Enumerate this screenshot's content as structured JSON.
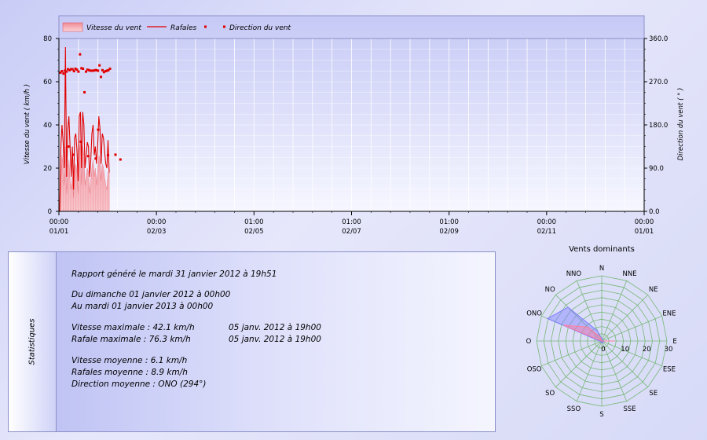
{
  "chart_data": [
    {
      "type": "line",
      "legend": {
        "placement": "top",
        "items": [
          {
            "label": "Vitesse du vent",
            "kind": "area",
            "color": "#f0a0a8"
          },
          {
            "label": "Rafales",
            "kind": "line",
            "color": "#e00000"
          },
          {
            "label": "Direction du vent",
            "kind": "points",
            "color": "#e00000"
          }
        ]
      },
      "ylabel_left": "Vitesse du vent  ( km/h )",
      "ylabel_right": "Direction du vent  ( ° )",
      "ylim_left": [
        0,
        80
      ],
      "ylim_right": [
        0,
        360
      ],
      "yticks_left": [
        "0",
        "20",
        "40",
        "60",
        "80"
      ],
      "yticks_right": [
        "0.0",
        "90.0",
        "180.0",
        "270.0",
        "360.0"
      ],
      "x_tick_labels": [
        {
          "time": "00:00",
          "date": "01/01"
        },
        {
          "time": "00:00",
          "date": "02/03"
        },
        {
          "time": "01:00",
          "date": "02/05"
        },
        {
          "time": "01:00",
          "date": "02/07"
        },
        {
          "time": "01:00",
          "date": "02/09"
        },
        {
          "time": "00:00",
          "date": "02/11"
        },
        {
          "time": "00:00",
          "date": "01/01"
        }
      ],
      "grid": true,
      "series": [
        {
          "name": "Vitesse du vent",
          "values": [
            0,
            14,
            26,
            22,
            12,
            30,
            8,
            20,
            24,
            14,
            10,
            16,
            6,
            20,
            22,
            18,
            8,
            28,
            32,
            12,
            30,
            26,
            12,
            16,
            20,
            18,
            8,
            14,
            20,
            24,
            16,
            20,
            12,
            18,
            26,
            24,
            14,
            22,
            20,
            16,
            12,
            10,
            18,
            18
          ]
        },
        {
          "name": "Rafales",
          "values": [
            0,
            30,
            40,
            32,
            20,
            76,
            16,
            38,
            44,
            30,
            16,
            30,
            10,
            34,
            36,
            28,
            14,
            44,
            46,
            20,
            46,
            40,
            20,
            26,
            32,
            30,
            16,
            24,
            36,
            40,
            26,
            30,
            22,
            30,
            44,
            38,
            22,
            36,
            34,
            28,
            22,
            20,
            33,
            18
          ]
        },
        {
          "name": "Direction du vent",
          "values": [
            289,
            292,
            287,
            293,
            291,
            296,
            294,
            296,
            296,
            292,
            297,
            295,
            291,
            327,
            298,
            297,
            248,
            291,
            295,
            294,
            293,
            293,
            293,
            294,
            294,
            293,
            304,
            280,
            294,
            290,
            292,
            293,
            294,
            297
          ],
          "outliers": [
            [
              1,
              135
            ],
            [
              6,
              145
            ],
            [
              13,
              170
            ],
            [
              3,
              118
            ],
            [
              9,
              115
            ],
            [
              12,
              110
            ],
            [
              17,
              117
            ],
            [
              20,
              118
            ],
            [
              22,
              108
            ]
          ]
        }
      ]
    },
    {
      "type": "radar",
      "title": "Vents dominants",
      "directions": [
        "N",
        "NNE",
        "NE",
        "ENE",
        "E",
        "ESE",
        "SE",
        "SSE",
        "S",
        "SSO",
        "SO",
        "OSO",
        "O",
        "ONO",
        "NO",
        "NNO"
      ],
      "radial_ticks": [
        "0",
        "10",
        "20",
        "30"
      ],
      "rmax": 30,
      "series": [
        {
          "color": "#7f7fff",
          "values": [
            1,
            1,
            0.5,
            0.5,
            1,
            1,
            0.5,
            0.5,
            1,
            0.5,
            0.5,
            0.5,
            1,
            27,
            22,
            5
          ]
        },
        {
          "color": "#ff7f9f",
          "values": [
            0,
            0,
            0,
            0,
            6,
            0,
            0,
            0,
            0,
            0,
            0,
            0,
            0,
            19,
            9,
            2
          ]
        }
      ]
    }
  ],
  "stats": {
    "side_label": "Statistiques",
    "report_line": "Rapport généré le mardi 31 janvier 2012 à 19h51",
    "from_line": "Du dimanche 01 janvier 2012 à 00h00",
    "to_line": "Au mardi 01 janvier 2013 à 00h00",
    "max_speed": "Vitesse maximale : 42.1 km/h",
    "max_speed_time": "05 janv. 2012 à 19h00",
    "max_gust": "Rafale maximale : 76.3 km/h",
    "max_gust_time": "05 janv. 2012 à 19h00",
    "avg_speed": "Vitesse moyenne : 6.1 km/h",
    "avg_gust": "Rafales moyenne : 8.9 km/h",
    "avg_direction": "Direction moyenne : ONO (294°)"
  }
}
